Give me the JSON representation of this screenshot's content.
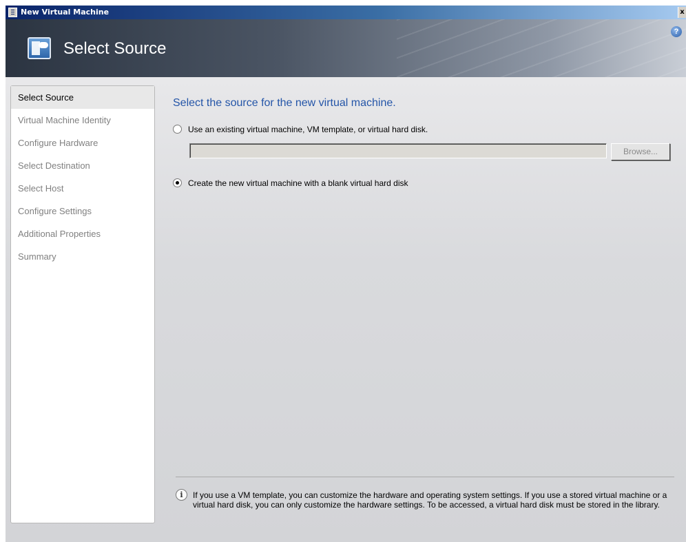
{
  "window": {
    "title": "New Virtual Machine",
    "close_glyph": "x"
  },
  "banner": {
    "title": "Select Source",
    "icon": "new-vm-icon",
    "help_glyph": "?"
  },
  "sidebar": {
    "items": [
      {
        "label": "Select Source",
        "active": true
      },
      {
        "label": "Virtual Machine Identity",
        "active": false
      },
      {
        "label": "Configure Hardware",
        "active": false
      },
      {
        "label": "Select Destination",
        "active": false
      },
      {
        "label": "Select Host",
        "active": false
      },
      {
        "label": "Configure Settings",
        "active": false
      },
      {
        "label": "Additional Properties",
        "active": false
      },
      {
        "label": "Summary",
        "active": false
      }
    ]
  },
  "main": {
    "heading": "Select the source for the new virtual machine.",
    "option_existing": {
      "label": "Use an existing virtual machine, VM template, or virtual hard disk.",
      "checked": false
    },
    "path_field": {
      "value": ""
    },
    "browse_label": "Browse...",
    "option_blank": {
      "label": "Create the new virtual machine with a blank virtual hard disk",
      "checked": true
    },
    "info_glyph": "i",
    "info_text": "If you use a VM template, you can customize the hardware and operating system settings. If you use a stored virtual machine or a virtual hard disk, you can only customize the hardware settings. To be accessed, a virtual hard disk must be stored in the library."
  },
  "colors": {
    "heading": "#2455a8",
    "title_bar": "#0a246a",
    "banner_dark": "#2b3441"
  }
}
